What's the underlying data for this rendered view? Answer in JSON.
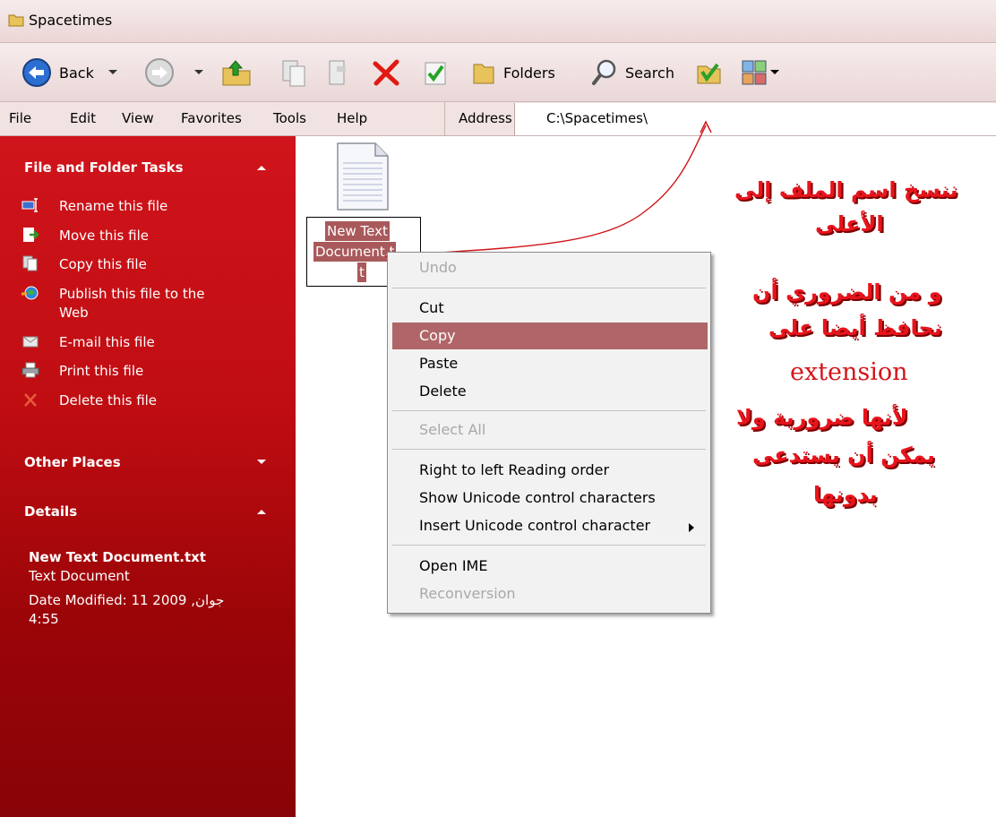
{
  "window": {
    "title": "Spacetimes"
  },
  "toolbar": {
    "back_label": "Back",
    "folders_label": "Folders",
    "search_label": "Search"
  },
  "menubar": {
    "items": [
      "File",
      "Edit",
      "View",
      "Favorites",
      "Tools",
      "Help"
    ],
    "address_label": "Address",
    "address_value": "C:\\Spacetimes\\"
  },
  "sidebar": {
    "file_tasks_header": "File and Folder Tasks",
    "tasks": [
      {
        "label": "Rename this file",
        "icon": "rename-icon"
      },
      {
        "label": "Move this file",
        "icon": "move-icon"
      },
      {
        "label": "Copy this file",
        "icon": "copy-icon"
      },
      {
        "label": "Publish this file to the",
        "label2": "Web",
        "icon": "publish-web-icon"
      },
      {
        "label": "E-mail this file",
        "icon": "email-icon"
      },
      {
        "label": "Print this file",
        "icon": "print-icon"
      },
      {
        "label": "Delete this file",
        "icon": "delete-icon"
      }
    ],
    "other_places_header": "Other Places",
    "details_header": "Details",
    "details": {
      "name": "New Text Document.txt",
      "type": "Text Document",
      "date_line": "Date Modified: 11 2009 ,جوان",
      "time": "4:55"
    }
  },
  "file": {
    "label_lines": [
      "New Text",
      "Document.t",
      "t"
    ]
  },
  "context_menu": {
    "undo": "Undo",
    "cut": "Cut",
    "copy": "Copy",
    "paste": "Paste",
    "delete": "Delete",
    "select_all": "Select All",
    "rtl": "Right to left Reading order",
    "show_unicode": "Show Unicode control characters",
    "insert_unicode": "Insert Unicode control character",
    "open_ime": "Open IME",
    "reconversion": "Reconversion",
    "highlighted": "Copy"
  },
  "annotation": {
    "line1": "ننسخ اسم الملف إلى",
    "line2": "الأعلى",
    "line3": "و من الضروري أن",
    "line4": "نحافظ أيضا على",
    "extension": "extension",
    "line5": "لأنها ضرورية ولا",
    "line6": "يمكن أن يستدعى",
    "line7": "بدونها",
    "color": "#e8141c"
  },
  "colors": {
    "sidebar_top": "#d0141b",
    "sidebar_bottom": "#880307",
    "menu_highlight": "#b06668"
  }
}
